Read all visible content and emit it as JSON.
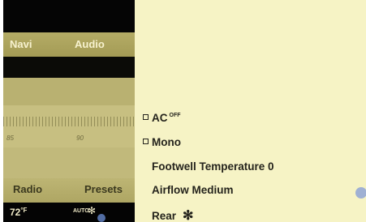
{
  "header_tabs": {
    "navi": "Navi",
    "audio": "Audio"
  },
  "tuner": {
    "scale_labels": [
      "85",
      "90"
    ]
  },
  "footer_tabs": {
    "radio": "Radio",
    "presets": "Presets"
  },
  "climate": {
    "temperature": "72",
    "temperature_unit": "°F",
    "auto_label": "AUTO",
    "fan_icon": "fan-icon"
  },
  "menu": {
    "ac": {
      "label": "AC",
      "status": "OFF",
      "checked": false
    },
    "mono": {
      "label": "Mono",
      "checked": false
    },
    "footwell": "Footwell Temperature  0",
    "airflow": "Airflow Medium",
    "rear": {
      "label": "Rear",
      "icon": "fan-icon"
    }
  },
  "colors": {
    "menu_background": "#f6f3c5",
    "menu_text": "#24231c",
    "accent_strip": "#b4ac66",
    "screen_dark": "#0c0c08"
  }
}
